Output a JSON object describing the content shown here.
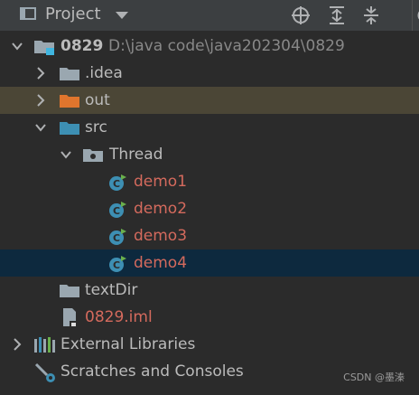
{
  "header": {
    "title": "Project"
  },
  "tree": {
    "root": {
      "name": "0829",
      "path": "D:\\java code\\java202304\\0829"
    },
    "idea": ".idea",
    "out": "out",
    "src": "src",
    "thread": "Thread",
    "demos": [
      "demo1",
      "demo2",
      "demo3",
      "demo4"
    ],
    "textDir": "textDir",
    "iml": "0829.iml",
    "external": "External Libraries",
    "scratches": "Scratches and Consoles"
  },
  "watermark": "CSDN @墨溱",
  "colors": {
    "background": "#2b2b2b",
    "header": "#3c3f41",
    "selected_row": "#0d293e",
    "highlight_row": "#4b4636",
    "modified_file": "#d46a5d"
  }
}
